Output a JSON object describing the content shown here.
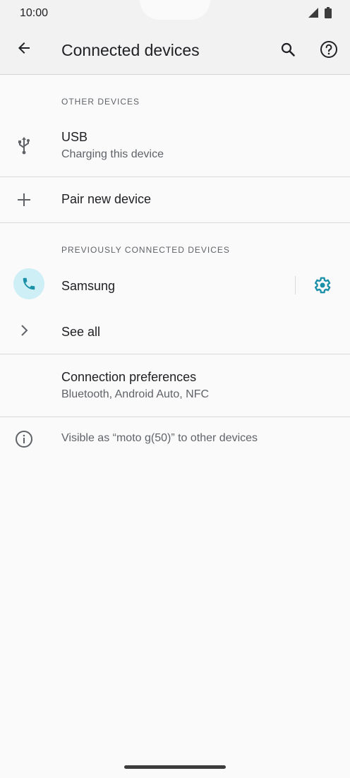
{
  "status": {
    "time": "10:00"
  },
  "header": {
    "title": "Connected devices"
  },
  "sections": {
    "other_devices": "OTHER DEVICES",
    "previously_connected": "PREVIOUSLY CONNECTED DEVICES"
  },
  "items": {
    "usb": {
      "title": "USB",
      "subtitle": "Charging this device"
    },
    "pair": {
      "title": "Pair new device"
    },
    "samsung": {
      "title": "Samsung"
    },
    "see_all": {
      "title": "See all"
    },
    "prefs": {
      "title": "Connection preferences",
      "subtitle": "Bluetooth, Android Auto, NFC"
    }
  },
  "footer": {
    "visible_text": "Visible as “moto g(50)” to other devices"
  },
  "icons": {
    "back": "arrow-back-icon",
    "search": "search-icon",
    "help": "help-icon",
    "usb": "usb-icon",
    "add": "plus-icon",
    "phone": "phone-icon",
    "settings": "gear-icon",
    "chevron": "chevron-right-icon",
    "info": "info-icon",
    "signal": "signal-icon",
    "battery": "battery-icon"
  },
  "colors": {
    "accent": "#1a8fa8",
    "avatar_bg": "#cdeff5"
  }
}
